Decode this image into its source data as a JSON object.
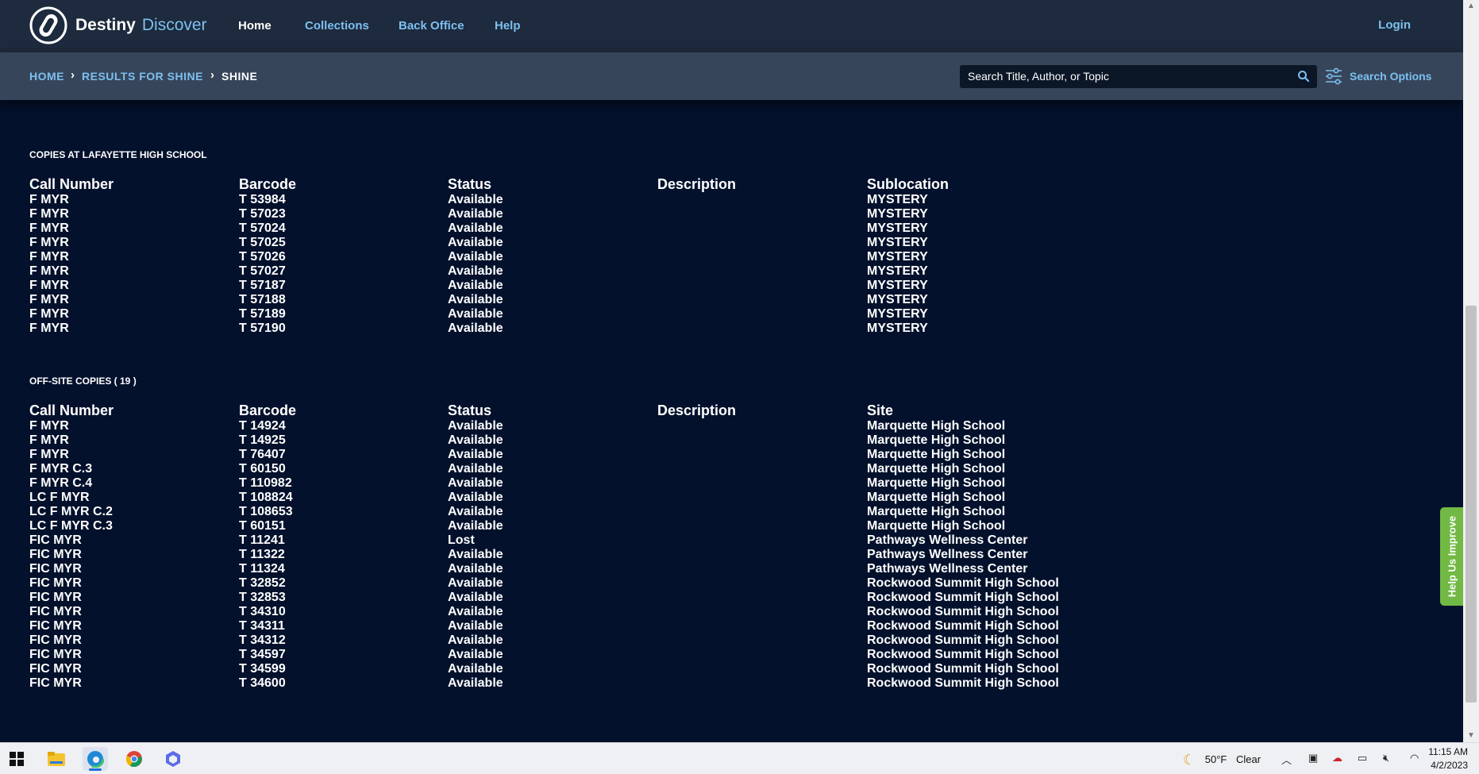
{
  "header": {
    "brand_primary": "Destiny",
    "brand_secondary": "Discover",
    "nav": [
      "Home",
      "Collections",
      "Back Office",
      "Help"
    ],
    "login_label": "Login"
  },
  "breadcrumb": {
    "home": "HOME",
    "results": "RESULTS FOR SHINE",
    "current": "SHINE"
  },
  "search": {
    "placeholder": "Search Title, Author, or Topic",
    "options_label": "Search Options"
  },
  "local_copies": {
    "title": "COPIES AT LAFAYETTE HIGH SCHOOL",
    "columns": [
      "Call Number",
      "Barcode",
      "Status",
      "Description",
      "Sublocation"
    ],
    "rows": [
      [
        "F MYR",
        "T 53984",
        "Available",
        "",
        "MYSTERY"
      ],
      [
        "F MYR",
        "T 57023",
        "Available",
        "",
        "MYSTERY"
      ],
      [
        "F MYR",
        "T 57024",
        "Available",
        "",
        "MYSTERY"
      ],
      [
        "F MYR",
        "T 57025",
        "Available",
        "",
        "MYSTERY"
      ],
      [
        "F MYR",
        "T 57026",
        "Available",
        "",
        "MYSTERY"
      ],
      [
        "F MYR",
        "T 57027",
        "Available",
        "",
        "MYSTERY"
      ],
      [
        "F MYR",
        "T 57187",
        "Available",
        "",
        "MYSTERY"
      ],
      [
        "F MYR",
        "T 57188",
        "Available",
        "",
        "MYSTERY"
      ],
      [
        "F MYR",
        "T 57189",
        "Available",
        "",
        "MYSTERY"
      ],
      [
        "F MYR",
        "T 57190",
        "Available",
        "",
        "MYSTERY"
      ]
    ]
  },
  "offsite_copies": {
    "title": "OFF-SITE COPIES ( 19 )",
    "columns": [
      "Call Number",
      "Barcode",
      "Status",
      "Description",
      "Site"
    ],
    "rows": [
      [
        "F MYR",
        "T 14924",
        "Available",
        "",
        "Marquette High School"
      ],
      [
        "F MYR",
        "T 14925",
        "Available",
        "",
        "Marquette High School"
      ],
      [
        "F MYR",
        "T 76407",
        "Available",
        "",
        "Marquette High School"
      ],
      [
        "F MYR C.3",
        "T 60150",
        "Available",
        "",
        "Marquette High School"
      ],
      [
        "F MYR C.4",
        "T 110982",
        "Available",
        "",
        "Marquette High School"
      ],
      [
        "LC F MYR",
        "T 108824",
        "Available",
        "",
        "Marquette High School"
      ],
      [
        "LC F MYR C.2",
        "T 108653",
        "Available",
        "",
        "Marquette High School"
      ],
      [
        "LC F MYR C.3",
        "T 60151",
        "Available",
        "",
        "Marquette High School"
      ],
      [
        "FIC MYR",
        "T 11241",
        "Lost",
        "",
        "Pathways Wellness Center"
      ],
      [
        "FIC MYR",
        "T 11322",
        "Available",
        "",
        "Pathways Wellness Center"
      ],
      [
        "FIC MYR",
        "T 11324",
        "Available",
        "",
        "Pathways Wellness Center"
      ],
      [
        "FIC MYR",
        "T 32852",
        "Available",
        "",
        "Rockwood Summit High School"
      ],
      [
        "FIC MYR",
        "T 32853",
        "Available",
        "",
        "Rockwood Summit High School"
      ],
      [
        "FIC MYR",
        "T 34310",
        "Available",
        "",
        "Rockwood Summit High School"
      ],
      [
        "FIC MYR",
        "T 34311",
        "Available",
        "",
        "Rockwood Summit High School"
      ],
      [
        "FIC MYR",
        "T 34312",
        "Available",
        "",
        "Rockwood Summit High School"
      ],
      [
        "FIC MYR",
        "T 34597",
        "Available",
        "",
        "Rockwood Summit High School"
      ],
      [
        "FIC MYR",
        "T 34599",
        "Available",
        "",
        "Rockwood Summit High School"
      ],
      [
        "FIC MYR",
        "T 34600",
        "Available",
        "",
        "Rockwood Summit High School"
      ]
    ]
  },
  "help_tab": "Help Us Improve",
  "taskbar": {
    "weather_temp": "50°F",
    "weather_desc": "Clear",
    "time": "11:15 AM",
    "date": "4/2/2023",
    "apps": [
      "windows-start-icon",
      "file-explorer-icon",
      "edge-icon",
      "chrome-icon",
      "copilot-icon"
    ]
  },
  "colors": {
    "page_bg": "#03112c",
    "nav_bg": "#1e2a3d",
    "subbar_bg": "#37455a",
    "link": "#7cc0f0",
    "help_tab": "#71b944"
  }
}
